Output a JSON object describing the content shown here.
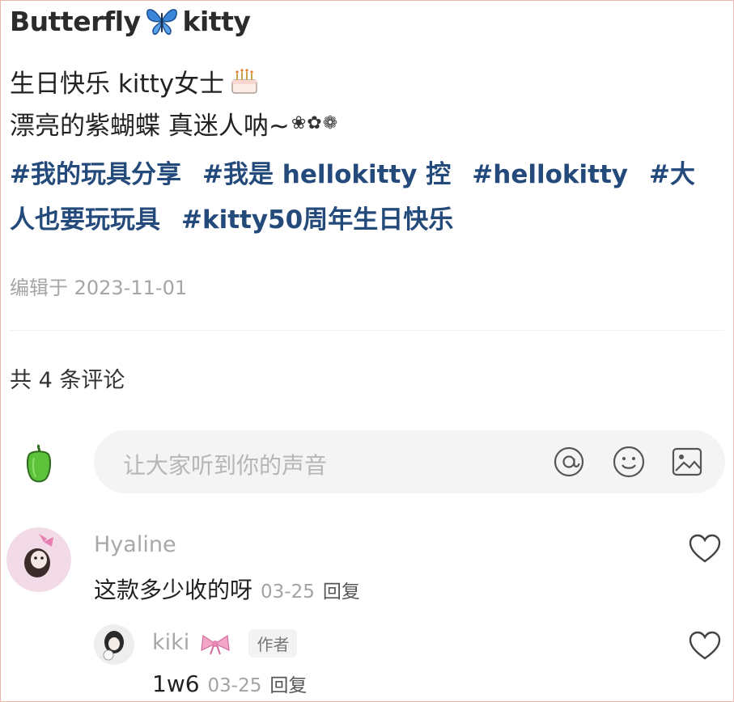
{
  "post": {
    "title_left": "Butterfly",
    "title_right": "kitty",
    "line1": "生日快乐 kitty女士",
    "line2": "漂亮的紫蝴蝶 真迷人呐~",
    "line2_flowers": "❀✿❁",
    "tags_row1": [
      "#我的玩具分享",
      "#我是 hellokitty 控",
      "#hellokitty",
      "#大"
    ],
    "tags_row2": [
      "人也要玩玩具",
      "#kitty50周年生日快乐"
    ],
    "edited": "编辑于 2023-11-01"
  },
  "comments_section": {
    "count_label": "共 4 条评论",
    "input_placeholder": "让大家听到你的声音"
  },
  "comments": [
    {
      "user": "Hyaline",
      "text": "这款多少收的呀",
      "date": "03-25",
      "reply_label": "回复",
      "replies": [
        {
          "user": "kiki",
          "badge": "作者",
          "text": "1w6",
          "date": "03-25",
          "reply_label": "回复"
        }
      ]
    }
  ],
  "icons": {
    "title_emoji": "butterfly-icon",
    "cake": "birthday-cake-icon",
    "at": "at-icon",
    "emoji": "smiley-icon",
    "image": "image-icon",
    "like": "heart-icon",
    "bow": "pink-bow-icon"
  },
  "colors": {
    "hashtag": "#234a7a",
    "muted": "#a8a8a8",
    "input_bg": "#f4f4f4"
  }
}
